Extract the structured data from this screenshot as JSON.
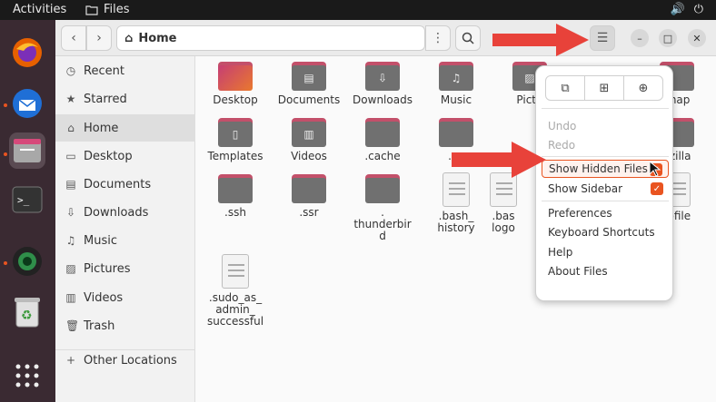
{
  "topbar": {
    "activities": "Activities",
    "app_name": "Files",
    "sound_icon": "🔊",
    "power_icon": "⏻"
  },
  "header": {
    "path": "Home"
  },
  "sidebar": {
    "items": [
      {
        "label": "Recent",
        "icon": "◷"
      },
      {
        "label": "Starred",
        "icon": "★"
      },
      {
        "label": "Home",
        "icon": "⌂"
      },
      {
        "label": "Desktop",
        "icon": "▭"
      },
      {
        "label": "Documents",
        "icon": "▤"
      },
      {
        "label": "Downloads",
        "icon": "⇩"
      },
      {
        "label": "Music",
        "icon": "♫"
      },
      {
        "label": "Pictures",
        "icon": "▨"
      },
      {
        "label": "Videos",
        "icon": "▥"
      },
      {
        "label": "Trash",
        "icon": "🗑"
      }
    ],
    "other_locations": {
      "label": "Other Locations",
      "icon": "+"
    }
  },
  "files": [
    {
      "name": "Desktop"
    },
    {
      "name": "Documents"
    },
    {
      "name": "Downloads"
    },
    {
      "name": "Music"
    },
    {
      "name": "Pictu"
    },
    {
      "name": "snap"
    },
    {
      "name": "Templates"
    },
    {
      "name": "Videos"
    },
    {
      "name": ".cache"
    },
    {
      "name": ".co"
    },
    {
      "name": "ozilla"
    },
    {
      "name": ".ssh"
    },
    {
      "name": ".ssr"
    },
    {
      "name": ".\nthunderbir\nd"
    },
    {
      "name": ".bash_\nhistory"
    },
    {
      "name": ".bas\nlogo"
    },
    {
      "name": "rofile"
    },
    {
      "name": ".sudo_as_\nadmin_\nsuccessful"
    }
  ],
  "menu": {
    "undo": "Undo",
    "redo": "Redo",
    "show_hidden": "Show Hidden Files",
    "show_sidebar": "Show Sidebar",
    "preferences": "Preferences",
    "keyboard_shortcuts": "Keyboard Shortcuts",
    "help": "Help",
    "about": "About Files"
  },
  "colors": {
    "accent": "#e95420",
    "arrow": "#e8423a"
  }
}
